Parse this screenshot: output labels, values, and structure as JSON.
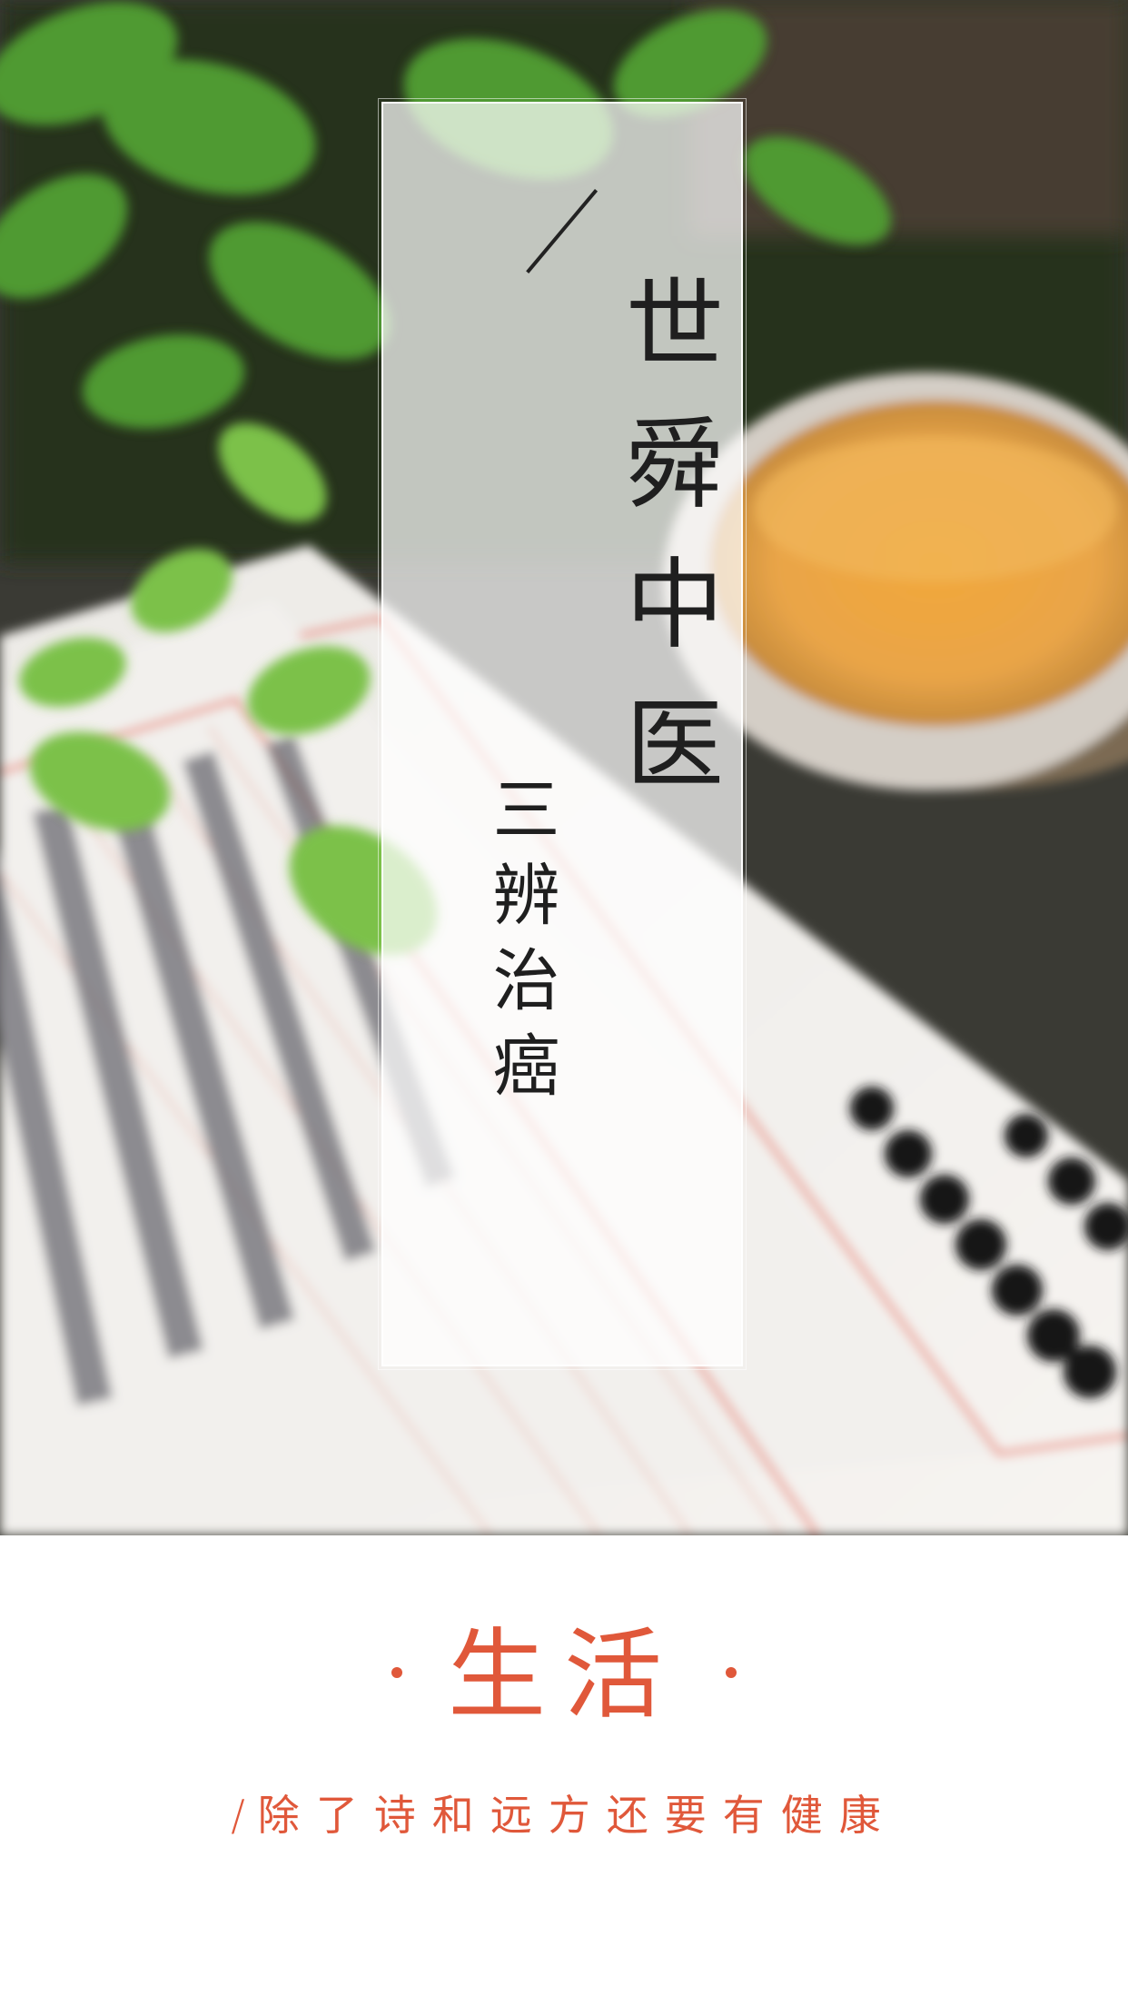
{
  "hero": {
    "title": "世舜中医",
    "subtitle": "三辨治癌"
  },
  "footer": {
    "heading": "生活",
    "tagline_prefix": "/",
    "tagline": "除了诗和远方还要有健康"
  },
  "colors": {
    "accent": "#e0583a",
    "title_text": "#1f1f1f"
  }
}
